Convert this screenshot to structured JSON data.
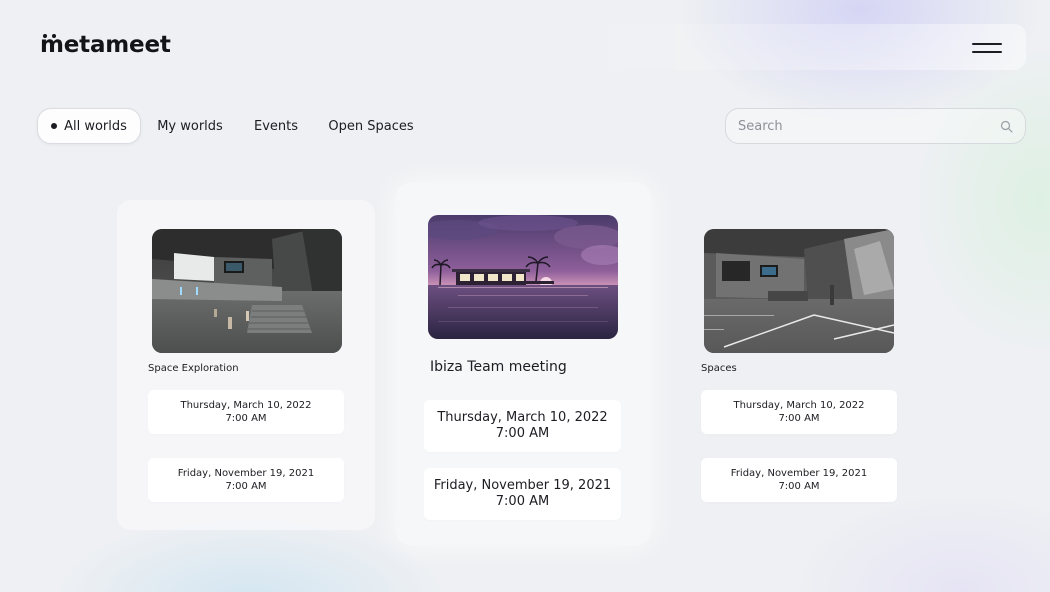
{
  "brand": {
    "logo_text": "metameet"
  },
  "header": {
    "menu_icon": "hamburger-menu-icon"
  },
  "tabs": [
    {
      "label": "All worlds",
      "active": true
    },
    {
      "label": "My worlds",
      "active": false
    },
    {
      "label": "Events",
      "active": false
    },
    {
      "label": "Open Spaces",
      "active": false
    }
  ],
  "search": {
    "placeholder": "Search",
    "value": "",
    "icon": "search-icon"
  },
  "worlds": [
    {
      "title": "Space Exploration",
      "thumbnail": "space-exploration-thumbnail",
      "dates": [
        {
          "date": "Thursday, March 10, 2022",
          "time": "7:00 AM"
        },
        {
          "date": "Friday, November 19, 2021",
          "time": "7:00 AM"
        }
      ]
    },
    {
      "title": "Ibiza Team meeting",
      "thumbnail": "ibiza-team-meeting-thumbnail",
      "dates": [
        {
          "date": "Thursday, March 10, 2022",
          "time": "7:00 AM"
        },
        {
          "date": "Friday, November 19, 2021",
          "time": "7:00 AM"
        }
      ]
    },
    {
      "title": "Spaces",
      "thumbnail": "spaces-thumbnail",
      "dates": [
        {
          "date": "Thursday, March 10, 2022",
          "time": "7:00 AM"
        },
        {
          "date": "Friday, November 19, 2021",
          "time": "7:00 AM"
        }
      ]
    }
  ],
  "colors": {
    "background": "#eef0f3",
    "text": "#1c1c22",
    "card": "#f7f8fa",
    "date_box": "#ffffff"
  }
}
